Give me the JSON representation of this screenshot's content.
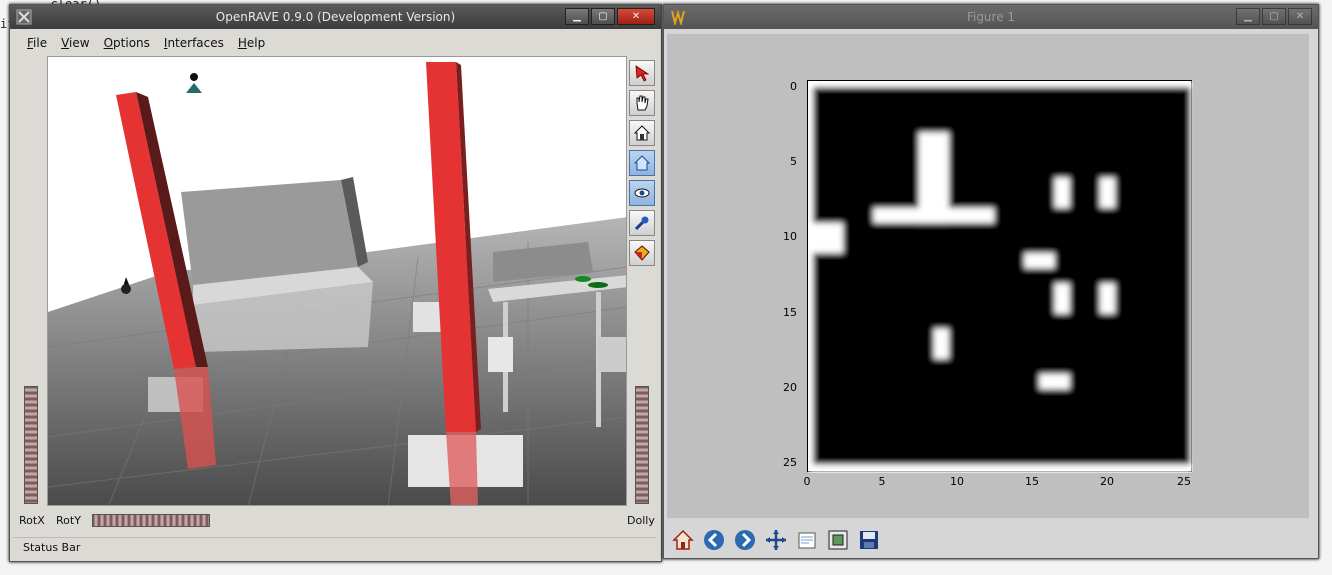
{
  "terminal": {
    "text": "      .clear()\nif"
  },
  "openrave": {
    "title": "OpenRAVE 0.9.0 (Development Version)",
    "menu": [
      "File",
      "View",
      "Options",
      "Interfaces",
      "Help"
    ],
    "labels": {
      "rotx": "RotX",
      "roty": "RotY",
      "dolly": "Dolly"
    },
    "status": "Status Bar",
    "tools": [
      "pointer-icon",
      "hand-icon",
      "home-icon",
      "set-home-icon",
      "view-all-icon",
      "seek-icon",
      "perspective-icon"
    ]
  },
  "figure": {
    "title": "Figure 1",
    "y_ticks": [
      "0",
      "5",
      "10",
      "15",
      "20",
      "25"
    ],
    "x_ticks": [
      "0",
      "5",
      "10",
      "15",
      "20",
      "25"
    ],
    "toolbar": [
      "home-icon",
      "back-icon",
      "forward-icon",
      "pan-icon",
      "zoom-icon",
      "subplots-icon",
      "save-icon"
    ]
  },
  "chart_data": {
    "type": "heatmap",
    "xlim": [
      0,
      25
    ],
    "ylim": [
      25,
      0
    ],
    "grid": false,
    "blocks": [
      {
        "label": "border",
        "x": [
          0,
          25
        ],
        "y": [
          0,
          25
        ],
        "value": 1
      },
      {
        "label": "interior",
        "x": [
          1,
          24
        ],
        "y": [
          1,
          24
        ],
        "value": 0
      },
      {
        "label": "t-stem",
        "x": [
          7,
          8
        ],
        "y": [
          3,
          8
        ],
        "value": 1
      },
      {
        "label": "t-bar",
        "x": [
          4,
          11
        ],
        "y": [
          8,
          8
        ],
        "value": 1
      },
      {
        "label": "left-notch",
        "x": [
          0,
          1
        ],
        "y": [
          9,
          10
        ],
        "value": 1
      },
      {
        "label": "b1",
        "x": [
          16,
          16
        ],
        "y": [
          6,
          7
        ],
        "value": 1
      },
      {
        "label": "b2",
        "x": [
          19,
          19
        ],
        "y": [
          6,
          7
        ],
        "value": 1
      },
      {
        "label": "b3",
        "x": [
          14,
          15
        ],
        "y": [
          11,
          11
        ],
        "value": 1
      },
      {
        "label": "b4",
        "x": [
          16,
          16
        ],
        "y": [
          13,
          14
        ],
        "value": 1
      },
      {
        "label": "b5",
        "x": [
          19,
          19
        ],
        "y": [
          13,
          14
        ],
        "value": 1
      },
      {
        "label": "b6",
        "x": [
          8,
          8
        ],
        "y": [
          16,
          17
        ],
        "value": 1
      },
      {
        "label": "b7",
        "x": [
          15,
          16
        ],
        "y": [
          19,
          19
        ],
        "value": 1
      }
    ]
  }
}
